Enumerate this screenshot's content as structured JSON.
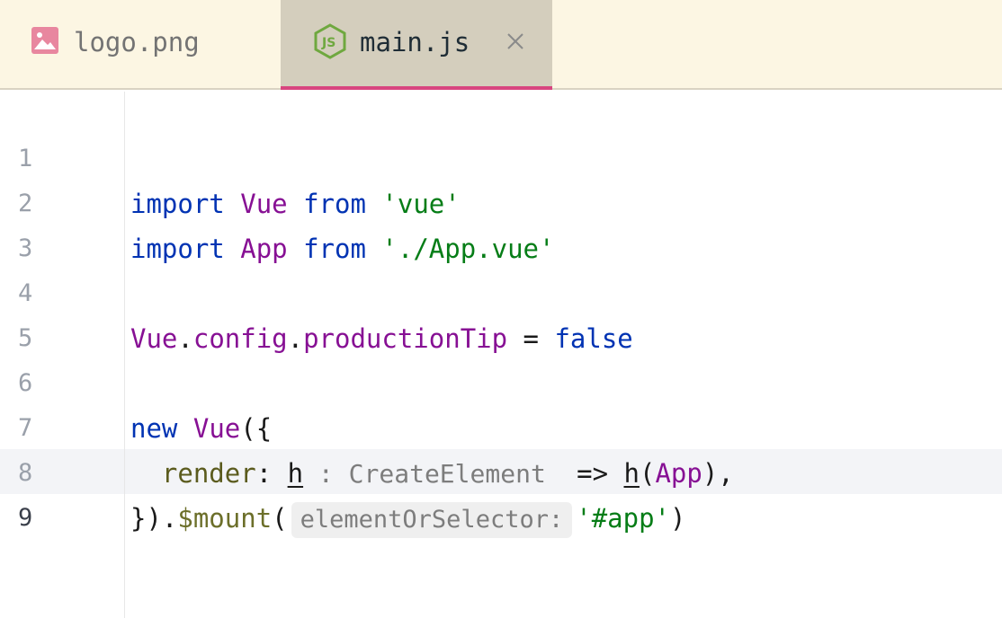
{
  "tabs": [
    {
      "label": "logo.png",
      "icon": "image-file-icon",
      "active": false
    },
    {
      "label": "main.js",
      "icon": "nodejs-file-icon",
      "active": true,
      "close_icon": "close-icon"
    }
  ],
  "editor": {
    "language": "JavaScript",
    "current_line": 9,
    "line_numbers": [
      "1",
      "2",
      "3",
      "4",
      "5",
      "6",
      "7",
      "8",
      "9"
    ],
    "lines": {
      "l1": {
        "t1": "import",
        "t2": " ",
        "t3": "Vue",
        "t4": " ",
        "t5": "from",
        "t6": " ",
        "t7": "'vue'"
      },
      "l2": {
        "t1": "import",
        "t2": " ",
        "t3": "App",
        "t4": " ",
        "t5": "from",
        "t6": " ",
        "t7": "'./App.vue'"
      },
      "l4": {
        "t1": "Vue",
        "t2": ".",
        "t3": "config",
        "t4": ".",
        "t5": "productionTip",
        "t6": " = ",
        "t7": "false"
      },
      "l6": {
        "t1": "new",
        "t2": " ",
        "t3": "Vue",
        "t4": "({"
      },
      "l7": {
        "t1": "  ",
        "t2": "render",
        "t3": ": ",
        "t4": "h",
        "t5": " : CreateElement ",
        "t6": " => ",
        "t7": "h",
        "t8": "(",
        "t9": "App",
        "t10": "),"
      },
      "l8": {
        "t1": "})",
        "t2": ".",
        "t3": "$mount",
        "t4": "(",
        "t5": "elementOrSelector:",
        "t6": "'#app'",
        "t7": ")"
      }
    }
  },
  "colors": {
    "keyword": "#0033b3",
    "identifier": "#871094",
    "string": "#067d17",
    "function": "#6c6f2a",
    "active_tab_underline": "#d8457f",
    "tabbar_background": "#fcf6e3"
  }
}
